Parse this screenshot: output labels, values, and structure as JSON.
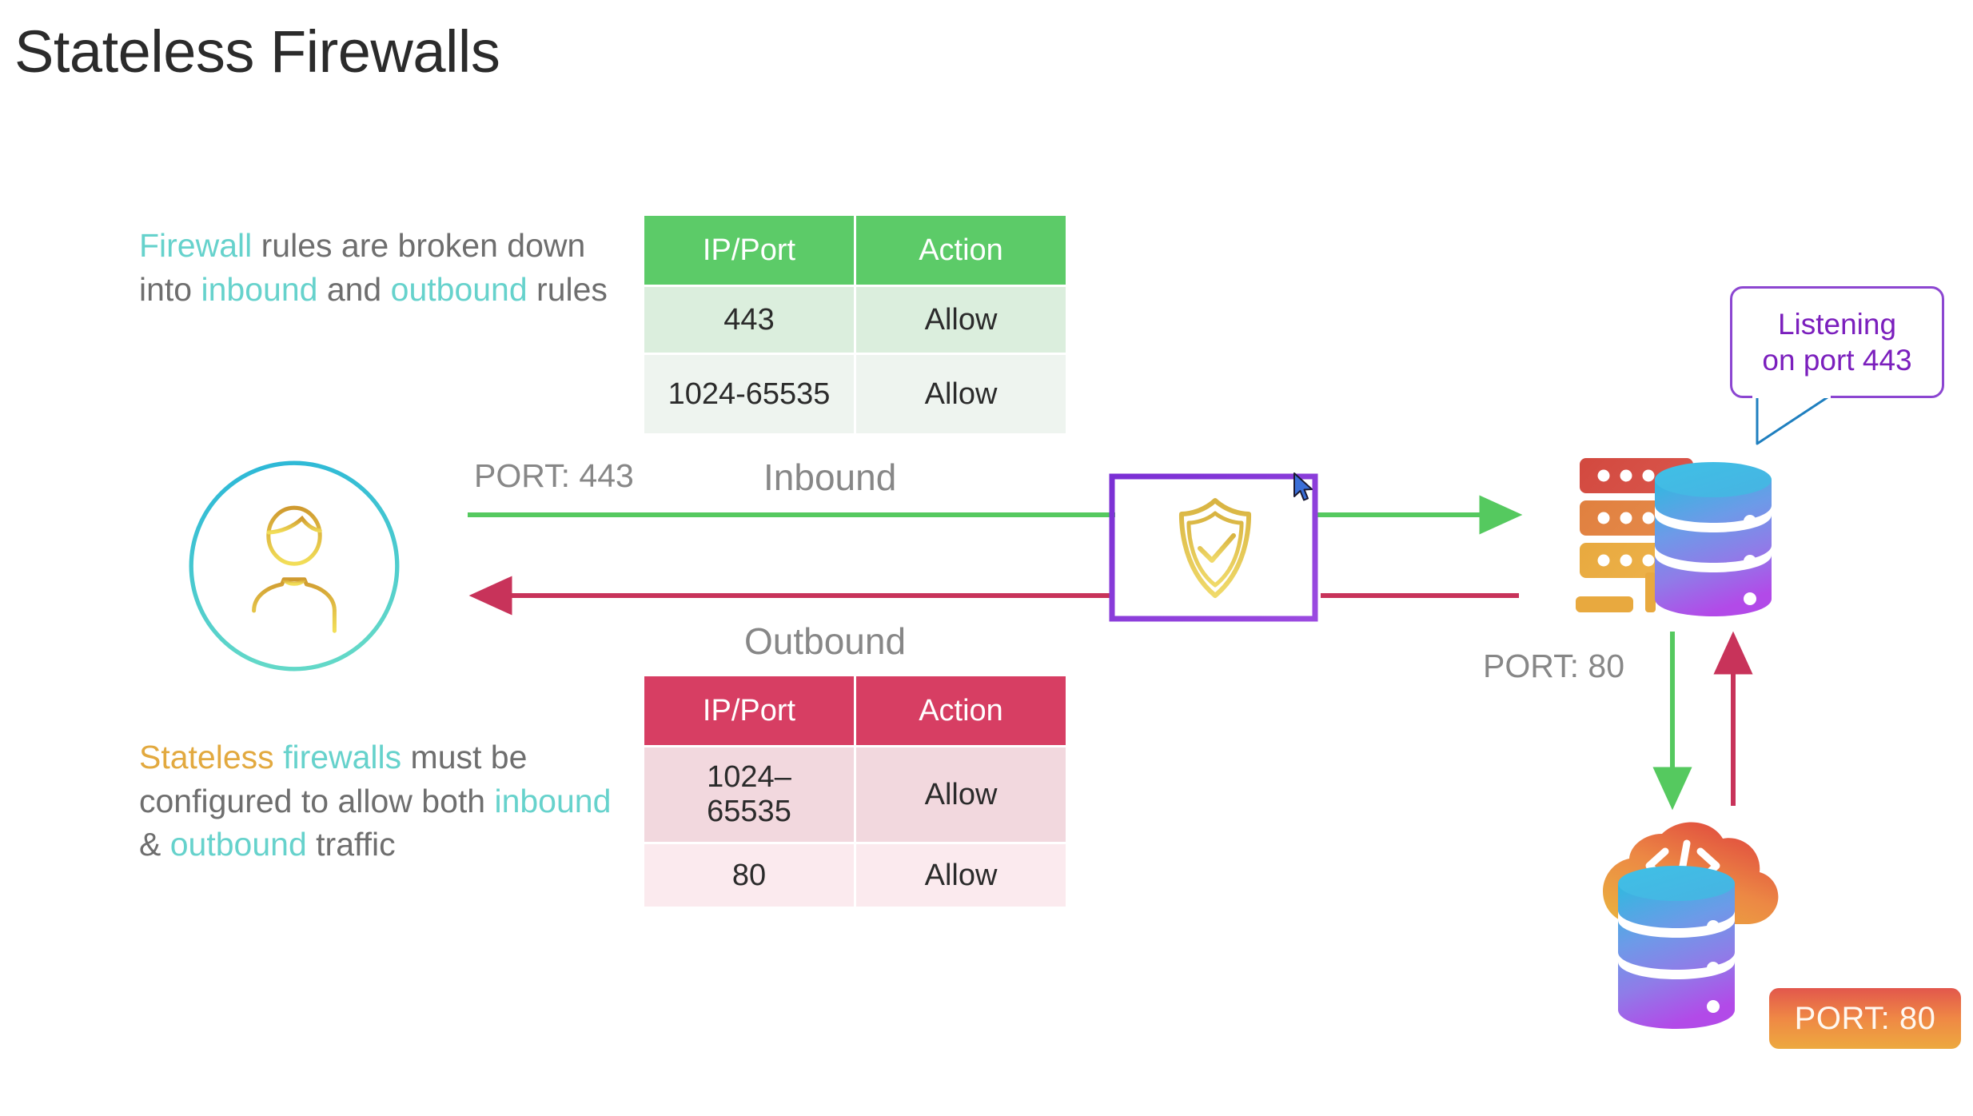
{
  "page": {
    "title": "Stateless Firewalls",
    "background": "#ffffff"
  },
  "colors": {
    "teal_keyword": "#66d2cc",
    "orange_keyword": "#e2a93f",
    "body_text": "#6e6e6e",
    "inbound_green": "#5ccb68",
    "inbound_row_light": "#dbeedd",
    "inbound_row_lighter": "#eef4ef",
    "outbound_red": "#d73e63",
    "outbound_row_light": "#f2d8de",
    "outbound_row_lighter": "#fbeaee",
    "firewall_purple": "#8b36d6",
    "shield_gold": "#e8c24a",
    "bubble_purple": "#7b1fbd",
    "arrow_green": "#5ccb68",
    "arrow_red": "#c8335a",
    "badge_gradient_from": "#e2574c",
    "badge_gradient_to": "#eda93f"
  },
  "paragraphs": {
    "top": {
      "segments": [
        {
          "text": "Firewall",
          "style": "teal"
        },
        {
          "text": " rules are broken down into ",
          "style": "plain"
        },
        {
          "text": "inbound",
          "style": "teal"
        },
        {
          "text": " and ",
          "style": "plain"
        },
        {
          "text": "outbound",
          "style": "teal"
        },
        {
          "text": " rules",
          "style": "plain"
        }
      ],
      "plain_text": "Firewall rules are broken down into inbound and outbound rules"
    },
    "bottom": {
      "segments": [
        {
          "text": "Stateless",
          "style": "orange"
        },
        {
          "text": " ",
          "style": "plain"
        },
        {
          "text": "firewalls",
          "style": "teal"
        },
        {
          "text": " must be configured to allow both ",
          "style": "plain"
        },
        {
          "text": "inbound",
          "style": "teal"
        },
        {
          "text": " & ",
          "style": "plain"
        },
        {
          "text": "outbound",
          "style": "teal"
        },
        {
          "text": " traffic",
          "style": "plain"
        }
      ],
      "plain_text": "Stateless firewalls must be configured to allow both inbound & outbound traffic"
    }
  },
  "tables": {
    "inbound": {
      "name": "Inbound rules",
      "headers": [
        "IP/Port",
        "Action"
      ],
      "rows": [
        [
          "443",
          "Allow"
        ],
        [
          "1024-65535",
          "Allow"
        ]
      ]
    },
    "outbound": {
      "name": "Outbound rules",
      "headers": [
        "IP/Port",
        "Action"
      ],
      "rows": [
        [
          "1024–\n65535",
          "Allow"
        ],
        [
          "80",
          "Allow"
        ]
      ]
    }
  },
  "flow": {
    "inbound_label": "Inbound",
    "outbound_label": "Outbound",
    "client_port_label": "PORT: 443",
    "server_port_label": "PORT: 80"
  },
  "speech_bubble": {
    "line1": "Listening",
    "line2": "on port 443",
    "text": "Listening on port 443"
  },
  "badge": {
    "label": "PORT: 80"
  },
  "icons": {
    "user": "user-avatar-icon",
    "firewall": "firewall-brick-wall-icon",
    "shield": "shield-check-icon",
    "server": "server-rack-database-icon",
    "cloud": "cloud-code-database-icon",
    "code_glyph": "</>",
    "cursor": "mouse-pointer-icon"
  }
}
